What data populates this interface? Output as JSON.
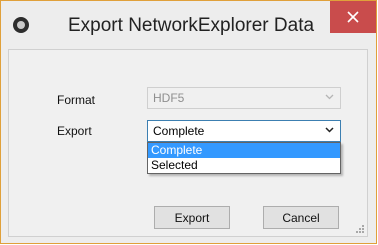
{
  "window": {
    "title": "Export NetworkExplorer Data",
    "app_icon": "networkexplorer-icon",
    "close_icon": "close-icon",
    "accent_border": "#e0a03a",
    "close_color": "#c94c4c"
  },
  "form": {
    "format_label": "Format",
    "format_value": "HDF5",
    "export_label": "Export",
    "export_value": "Complete",
    "export_options": [
      "Complete",
      "Selected"
    ],
    "highlighted_option": "Complete",
    "highlight_color": "#3399ff"
  },
  "buttons": {
    "export": "Export",
    "cancel": "Cancel"
  }
}
